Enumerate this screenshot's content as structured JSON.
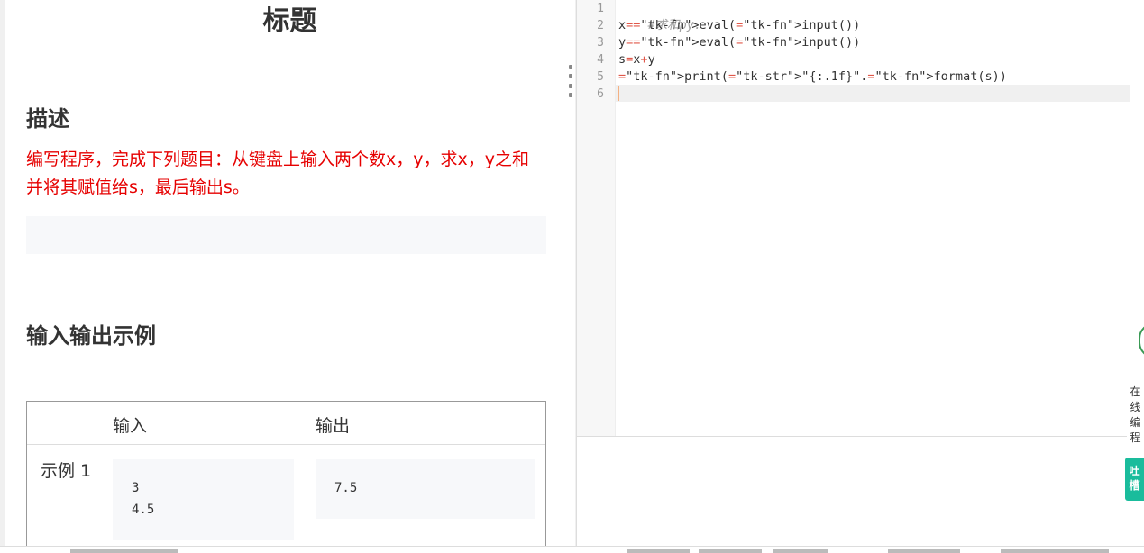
{
  "problem": {
    "title": "标题",
    "description_heading": "描述",
    "description": "编写程序，完成下列题目：从键盘上输入两个数x，y，求x，y之和并将其赋值给s，最后输出s。",
    "io_heading": "输入输出示例",
    "io_table": {
      "input_header": "输入",
      "output_header": "输出",
      "example_label": "示例 1",
      "input_lines": [
        "3",
        "4.5"
      ],
      "output_lines": [
        "7.5"
      ]
    }
  },
  "editor": {
    "line_numbers": [
      "1",
      "2",
      "3",
      "4",
      "5",
      "6"
    ],
    "code": [
      "#求和py.",
      "x=eval(input())",
      "y=eval(input())",
      "s=x+y",
      "print(\"{:.1f}\".format(s))",
      ""
    ]
  },
  "side": {
    "online_label": "在线编程",
    "feedback_label": "吐槽"
  },
  "colors": {
    "description_text": "#e60000",
    "feedback_tab": "#1abc9c",
    "float_button": "#3a9a55"
  }
}
